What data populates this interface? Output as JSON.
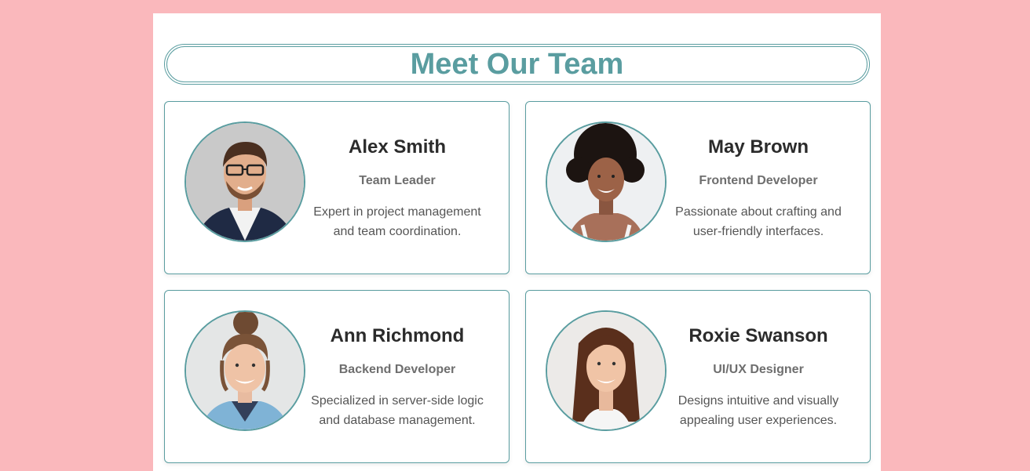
{
  "header": {
    "title": "Meet Our Team"
  },
  "team": [
    {
      "name": "Alex Smith",
      "role": "Team Leader",
      "desc": "Expert in project management and team coordination.",
      "avatar_icon": "man-portrait-icon"
    },
    {
      "name": "May Brown",
      "role": "Frontend Developer",
      "desc": "Passionate about crafting and user-friendly interfaces.",
      "avatar_icon": "woman-portrait-icon"
    },
    {
      "name": "Ann Richmond",
      "role": "Backend Developer",
      "desc": "Specialized in server-side logic and database management.",
      "avatar_icon": "woman-portrait-icon"
    },
    {
      "name": "Roxie Swanson",
      "role": "UI/UX Designer",
      "desc": "Designs intuitive and visually appealing user experiences.",
      "avatar_icon": "woman-portrait-icon"
    }
  ],
  "colors": {
    "background": "#fab8bc",
    "accent": "#5a9da0",
    "name_text": "#2b2b2b",
    "role_text": "#6e6e6e",
    "desc_text": "#555555"
  }
}
